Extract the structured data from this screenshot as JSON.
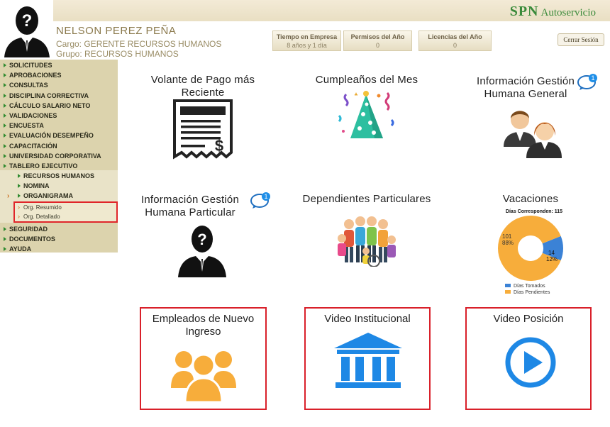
{
  "brand": {
    "logo_text": "SPN",
    "subtitle": "Autoservicio"
  },
  "user": {
    "name": "NELSON PEREZ PEÑA",
    "cargo": "Cargo: GERENTE RECURSOS HUMANOS",
    "grupo": "Grupo: RECURSOS HUMANOS"
  },
  "stats": [
    {
      "label": "Tiempo en Empresa",
      "value": "8 años y 1 día"
    },
    {
      "label": "Permisos del Año",
      "value": "0"
    },
    {
      "label": "Licencias del Año",
      "value": "0"
    }
  ],
  "logout_label": "Cerrar Sesión",
  "menu": [
    "SOLICITUDES",
    "APROBACIONES",
    "CONSULTAS",
    "DISCIPLINA CORRECTIVA",
    "CÁLCULO SALARIO NETO",
    "VALIDACIONES",
    "ENCUESTA",
    "EVALUACIÓN DESEMPEÑO",
    "CAPACITACIÓN",
    "UNIVERSIDAD CORPORATIVA",
    "TABLERO EJECUTIVO"
  ],
  "submenu": [
    "RECURSOS HUMANOS",
    "NOMINA",
    "ORGANIGRAMA"
  ],
  "org_items": [
    "Org. Resumido",
    "Org. Detallado"
  ],
  "menu_bottom": [
    "SEGURIDAD",
    "DOCUMENTOS",
    "AYUDA"
  ],
  "tiles": {
    "volante": {
      "title1": "Volante de Pago más",
      "title2": "Reciente"
    },
    "cumple": {
      "title1": "Cumpleaños del Mes"
    },
    "info_general": {
      "title1": "Información Gestión",
      "title2": "Humana General",
      "badge": "1"
    },
    "info_particular": {
      "title1": "Información Gestión",
      "title2": "Humana Particular",
      "badge": "1"
    },
    "dependientes": {
      "title1": "Dependientes Particulares"
    },
    "vacaciones": {
      "title1": "Vacaciones"
    },
    "empleados": {
      "title1": "Empleados de Nuevo",
      "title2": "Ingreso"
    },
    "video_inst": {
      "title1": "Video Institucional"
    },
    "video_pos": {
      "title1": "Video Posición"
    }
  },
  "chart_data": {
    "type": "pie",
    "title": "Días Corresponden: 115",
    "categories": [
      "Días Tomados",
      "Días Pendientes"
    ],
    "values": [
      14,
      101
    ],
    "percent_labels": [
      "12%",
      "88%"
    ],
    "colors": [
      "#3b82d6",
      "#f7ad3b"
    ],
    "legend": "bottom",
    "donut": true
  },
  "colors": {
    "accent_green": "#2f8a2f",
    "sidebar": "#dcd3ad",
    "highlight_red": "#d9202a",
    "orange": "#f7ad3b",
    "blue": "#1e88e5"
  }
}
